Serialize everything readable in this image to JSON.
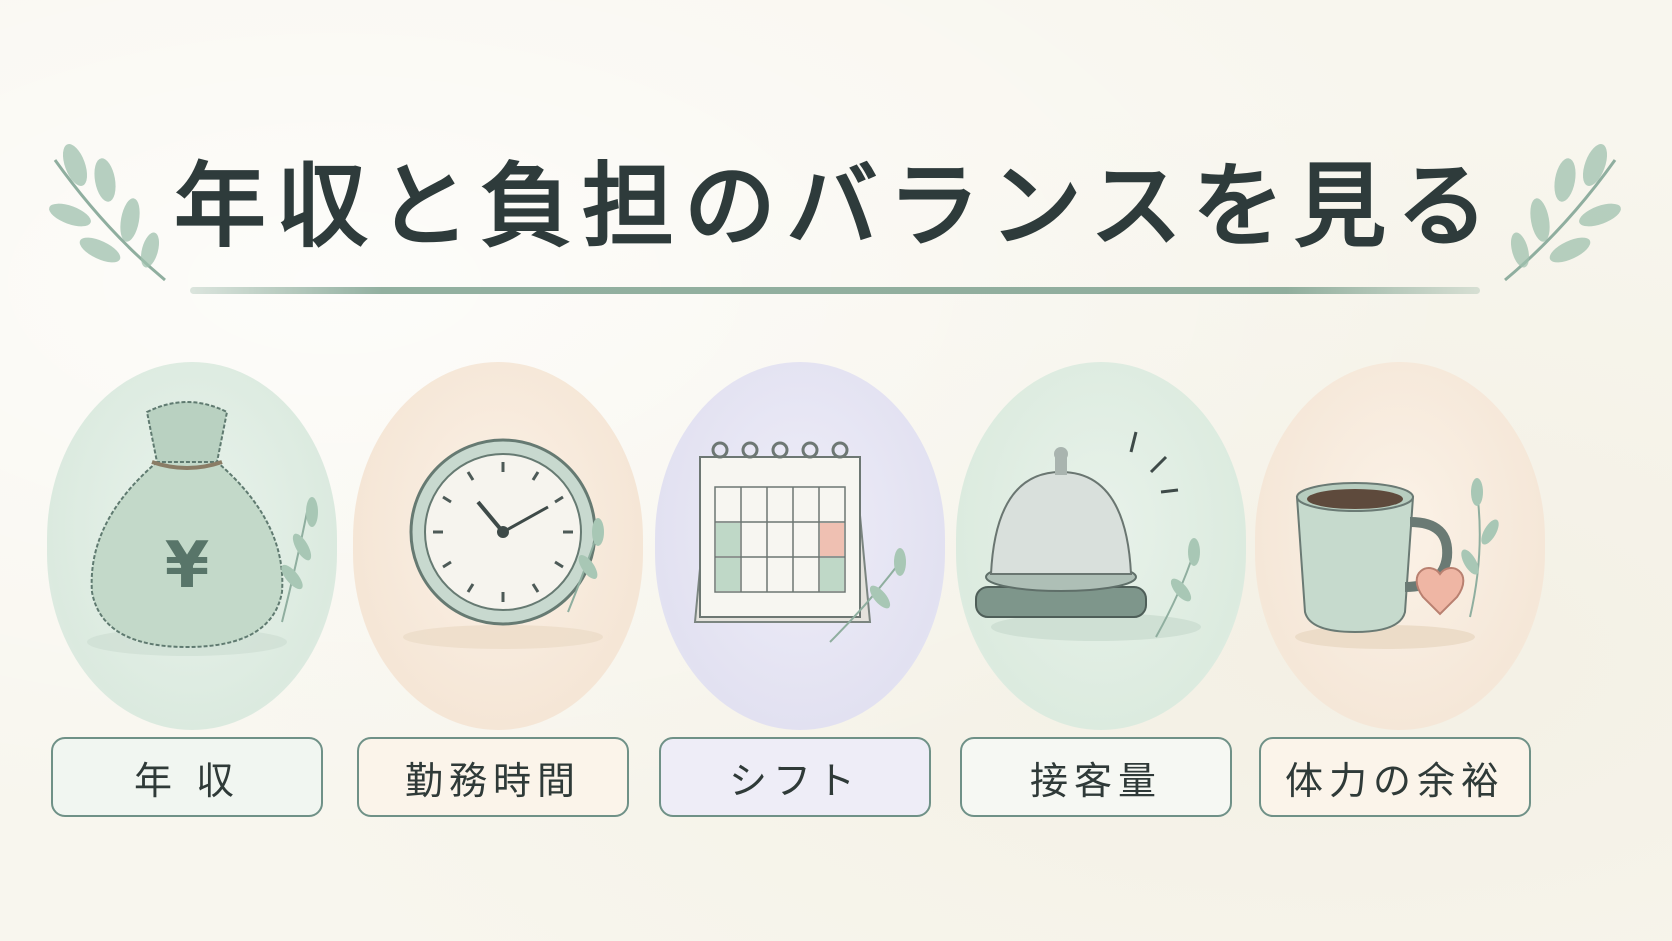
{
  "title": "年収と負担のバランスを見る",
  "colors": {
    "accent": "#6f9187",
    "mint": "#e3efe6",
    "peach": "#f8ece0",
    "lavender": "#e7e6f4"
  },
  "cards": [
    {
      "label": "年 収",
      "icon": "money-bag-icon",
      "symbol": "¥",
      "bg": "#e3efe6",
      "label_bg": "#f1f6f1"
    },
    {
      "label": "勤務時間",
      "icon": "clock-icon",
      "bg": "#f8ece0",
      "label_bg": "#fbf4ea"
    },
    {
      "label": "シフト",
      "icon": "calendar-icon",
      "bg": "#e7e6f4",
      "label_bg": "#eeedf7"
    },
    {
      "label": "接客量",
      "icon": "service-bell-icon",
      "bg": "#e3efe6",
      "label_bg": "#f6f8f3"
    },
    {
      "label": "体力の余裕",
      "icon": "coffee-mug-icon",
      "bg": "#f8ece0",
      "label_bg": "#fbf4ea"
    }
  ]
}
